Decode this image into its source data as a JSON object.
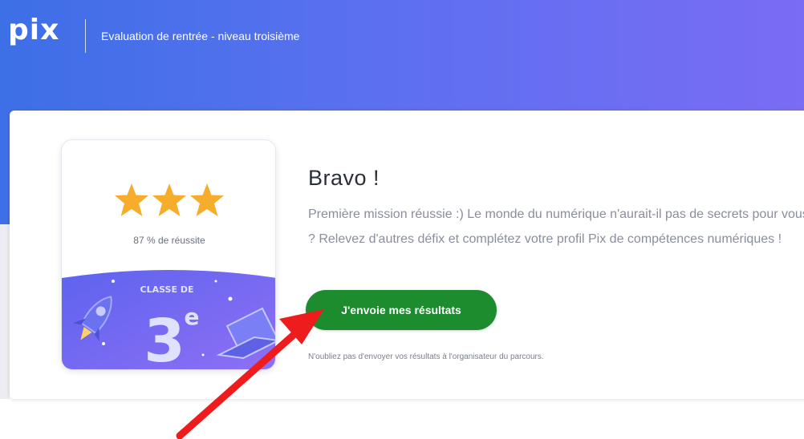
{
  "header": {
    "logo": "pix",
    "title": "Evaluation de rentrée - niveau troisième"
  },
  "badge": {
    "stars_filled": 3,
    "stars_total": 3,
    "success_text": "87 % de réussite",
    "class_label": "CLASSE DE",
    "class_number": "3",
    "class_suffix": "e"
  },
  "result": {
    "heading": "Bravo !",
    "message": "Première mission réussie :) Le monde du numérique n'aurait-il pas de secrets pour vous ? Relevez d'autres défix et complétez votre profil Pix de compétences numériques !",
    "send_button_label": "J'envoie mes résultats",
    "reminder": "N'oubliez pas d'envoyer vos résultats à l'organisateur du parcours."
  },
  "colors": {
    "header_gradient_start": "#3d6fe6",
    "header_gradient_end": "#7a6cf4",
    "button": "#1c8c2e",
    "star": "#f6ad2b",
    "arrow": "#ee1c1c"
  },
  "icons": [
    "star-icon",
    "rocket-icon",
    "laptop-icon",
    "sparkle-icon",
    "arrow-annotation"
  ]
}
